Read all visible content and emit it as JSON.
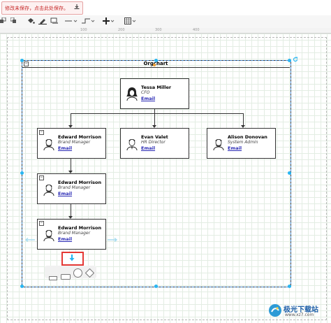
{
  "notice": {
    "text": "修改未保存，点击此处保存。",
    "download_icon": "download-icon"
  },
  "toolbar": {
    "icons": [
      "to-back-icon",
      "to-front-icon",
      "fill-icon",
      "line-color-icon",
      "shadow-icon",
      "connection-icon",
      "waypoints-icon",
      "insert-icon",
      "table-icon"
    ]
  },
  "ruler": {
    "ticks": [
      "100",
      "200",
      "300",
      "400"
    ]
  },
  "container": {
    "title": "Orgchart"
  },
  "cards": [
    {
      "name": "Tessa Miller",
      "role": "CFO",
      "email": "Email",
      "avatar": "female"
    },
    {
      "name": "Edward Morrison",
      "role": "Brand Manager",
      "email": "Email",
      "avatar": "male-beard"
    },
    {
      "name": "Evan Valet",
      "role": "HR Director",
      "email": "Email",
      "avatar": "male"
    },
    {
      "name": "Alison Donovan",
      "role": "System Admin",
      "email": "Email",
      "avatar": "male-beard"
    },
    {
      "name": "Edward Morrison",
      "role": "Brand Manager",
      "email": "Email",
      "avatar": "male-beard"
    },
    {
      "name": "Edward Morrison",
      "role": "Brand Manager",
      "email": "Email",
      "avatar": "male-beard"
    }
  ],
  "shape_picker": [
    "rectangle-icon",
    "rounded-rectangle-icon",
    "circle-icon",
    "diamond-icon"
  ],
  "watermark": {
    "brand": "极光下载站",
    "url": "www.xz7.com"
  },
  "colors": {
    "selection": "#29b6f2",
    "highlight": "#e53935",
    "link": "#2a2ab5"
  }
}
